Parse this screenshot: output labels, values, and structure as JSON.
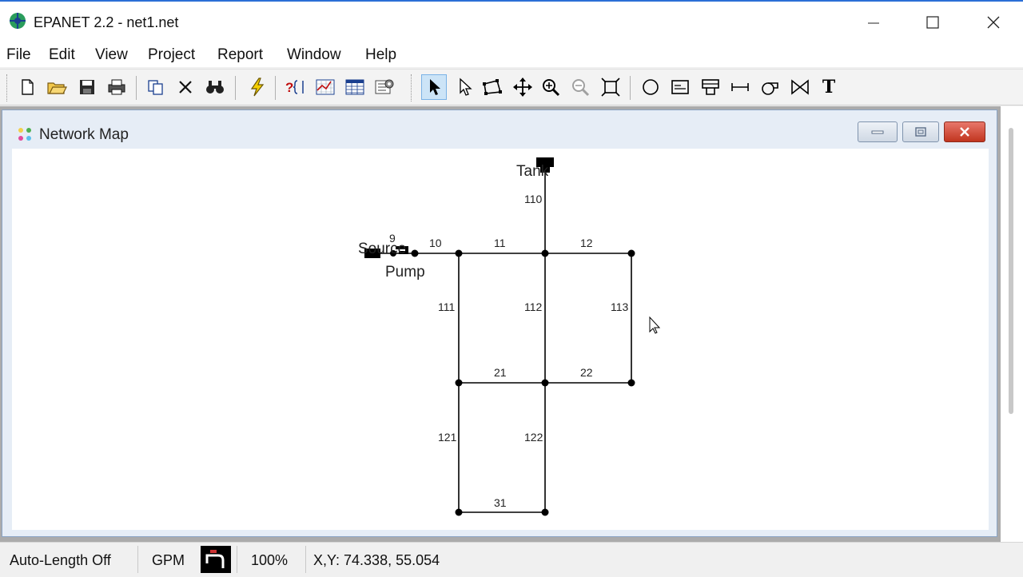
{
  "window": {
    "title": "EPANET 2.2 - net1.net"
  },
  "menu": [
    "File",
    "Edit",
    "View",
    "Project",
    "Report",
    "Window",
    "Help"
  ],
  "toolbar": {
    "buttons": [
      "new-icon",
      "open-icon",
      "save-icon",
      "print-icon",
      "copy-icon",
      "delete-icon",
      "find-icon",
      "run-icon",
      "query-icon",
      "graph-icon",
      "table-icon",
      "options-icon",
      "select-object-icon",
      "select-vertex-icon",
      "select-region-icon",
      "pan-icon",
      "zoom-in-icon",
      "zoom-out-icon",
      "full-extent-icon",
      "add-junction-icon",
      "add-reservoir-icon",
      "add-tank-icon",
      "add-pipe-icon",
      "add-pump-icon",
      "add-valve-icon",
      "add-label-icon"
    ],
    "active": "select-object-icon",
    "label_tool_glyph": "T"
  },
  "child_window": {
    "title": "Network Map"
  },
  "map": {
    "nodes": [
      {
        "id": "Source",
        "label": "Source",
        "type": "reservoir"
      },
      {
        "id": "Tank",
        "label": "Tank",
        "type": "tank"
      }
    ],
    "pump_label": "Pump",
    "link_labels": [
      "9",
      "10",
      "11",
      "12",
      "110",
      "111",
      "112",
      "113",
      "21",
      "22",
      "121",
      "122",
      "31"
    ]
  },
  "status": {
    "auto_length": "Auto-Length Off",
    "flow_units": "GPM",
    "zoom": "100%",
    "coordinates": "X,Y: 74.338, 55.054"
  },
  "colors": {
    "accent": "#2b6fd6",
    "close": "#c1351f"
  }
}
